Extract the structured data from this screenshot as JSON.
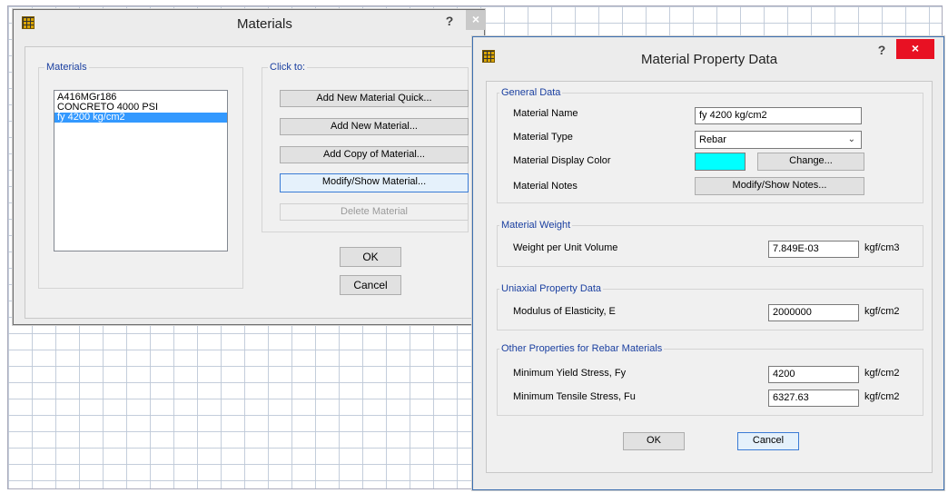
{
  "materials_dialog": {
    "title": "Materials",
    "help": "?",
    "close": "×",
    "materials_group_label": "Materials",
    "materials_list": [
      "A416MGr186",
      "CONCRETO 4000 PSI",
      "fy 4200 kg/cm2"
    ],
    "selected_material": "fy 4200 kg/cm2",
    "click_to_group_label": "Click to:",
    "buttons": {
      "add_quick": "Add New Material Quick...",
      "add_new": "Add New Material...",
      "add_copy": "Add Copy of Material...",
      "modify_show": "Modify/Show Material...",
      "delete": "Delete Material"
    },
    "ok": "OK",
    "cancel": "Cancel"
  },
  "property_dialog": {
    "title": "Material Property Data",
    "help": "?",
    "close": "×",
    "general": {
      "group_label": "General Data",
      "name_label": "Material Name",
      "name_value": "fy 4200 kg/cm2",
      "type_label": "Material Type",
      "type_value": "Rebar",
      "color_label": "Material Display Color",
      "color_value": "#00ffff",
      "change_button": "Change...",
      "notes_label": "Material Notes",
      "notes_button": "Modify/Show Notes..."
    },
    "weight": {
      "group_label": "Material Weight",
      "label": "Weight per Unit Volume",
      "value": "7.849E-03",
      "unit": "kgf/cm3"
    },
    "uniaxial": {
      "group_label": "Uniaxial Property Data",
      "label": "Modulus of Elasticity,  E",
      "value": "2000000",
      "unit": "kgf/cm2"
    },
    "rebar": {
      "group_label": "Other Properties for Rebar Materials",
      "fy_label": "Minimum Yield Stress, Fy",
      "fy_value": "4200",
      "fy_unit": "kgf/cm2",
      "fu_label": "Minimum Tensile Stress, Fu",
      "fu_value": "6327.63",
      "fu_unit": "kgf/cm2"
    },
    "ok": "OK",
    "cancel": "Cancel"
  },
  "colors": {
    "close_button": "#e81123",
    "close_button_inactive": "#c9c9c9",
    "selection": "#3399ff",
    "group_label": "#1a3fa0"
  }
}
